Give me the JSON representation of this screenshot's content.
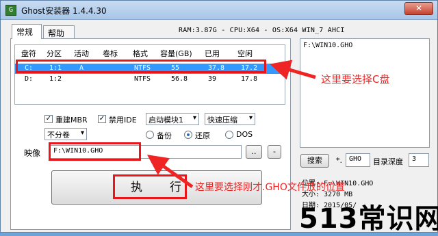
{
  "window": {
    "title": "Ghost安装器 1.4.4.30",
    "close_label": "✕",
    "app_icon": "G"
  },
  "tabs": [
    {
      "label": "常规"
    },
    {
      "label": "帮助"
    }
  ],
  "sysinfo": "RAM:3.87G - CPU:X64 - OS:X64 WIN_7 AHCI",
  "table": {
    "headers": [
      "盘符",
      "分区",
      "活动",
      "卷标",
      "格式",
      "容量(GB)",
      "已用",
      "空闲"
    ],
    "rows": [
      [
        "C:",
        "1:1",
        "A",
        "",
        "NTFS",
        "55",
        "37.8",
        "17.2"
      ],
      [
        "D:",
        "1:2",
        "",
        "",
        "NTFS",
        "56.8",
        "39",
        "17.8"
      ]
    ]
  },
  "options": {
    "rebuild_mbr": "重建MBR",
    "disable_ide": "禁用IDE",
    "boot_module": "启动模块1",
    "compression": "快速压缩",
    "split": "不分卷",
    "backup": "备份",
    "restore": "还原",
    "dos": "DOS"
  },
  "image": {
    "label": "映像",
    "path": "F:\\WIN10.GHO",
    "browse": "..",
    "minus": "-"
  },
  "execute": {
    "label": "执　　行"
  },
  "side": {
    "list_item": "F:\\WIN10.GHO",
    "search_label": "搜索",
    "ext_prefix": "*.",
    "ext_value": "GHO",
    "depth_label": "目录深度",
    "depth_value": "3",
    "location": "位置: F:\\WIN10.GHO",
    "size": "大小: 3270 MB",
    "date": "日期: 2015/05/"
  },
  "annotations": {
    "select_c": "这里要选择C盘",
    "select_gho": "这里要选择刚才.GHO文件放的位置"
  },
  "watermark": "513常识网",
  "colors": {
    "highlight": "#3399ff",
    "annotation": "#ef2525"
  }
}
